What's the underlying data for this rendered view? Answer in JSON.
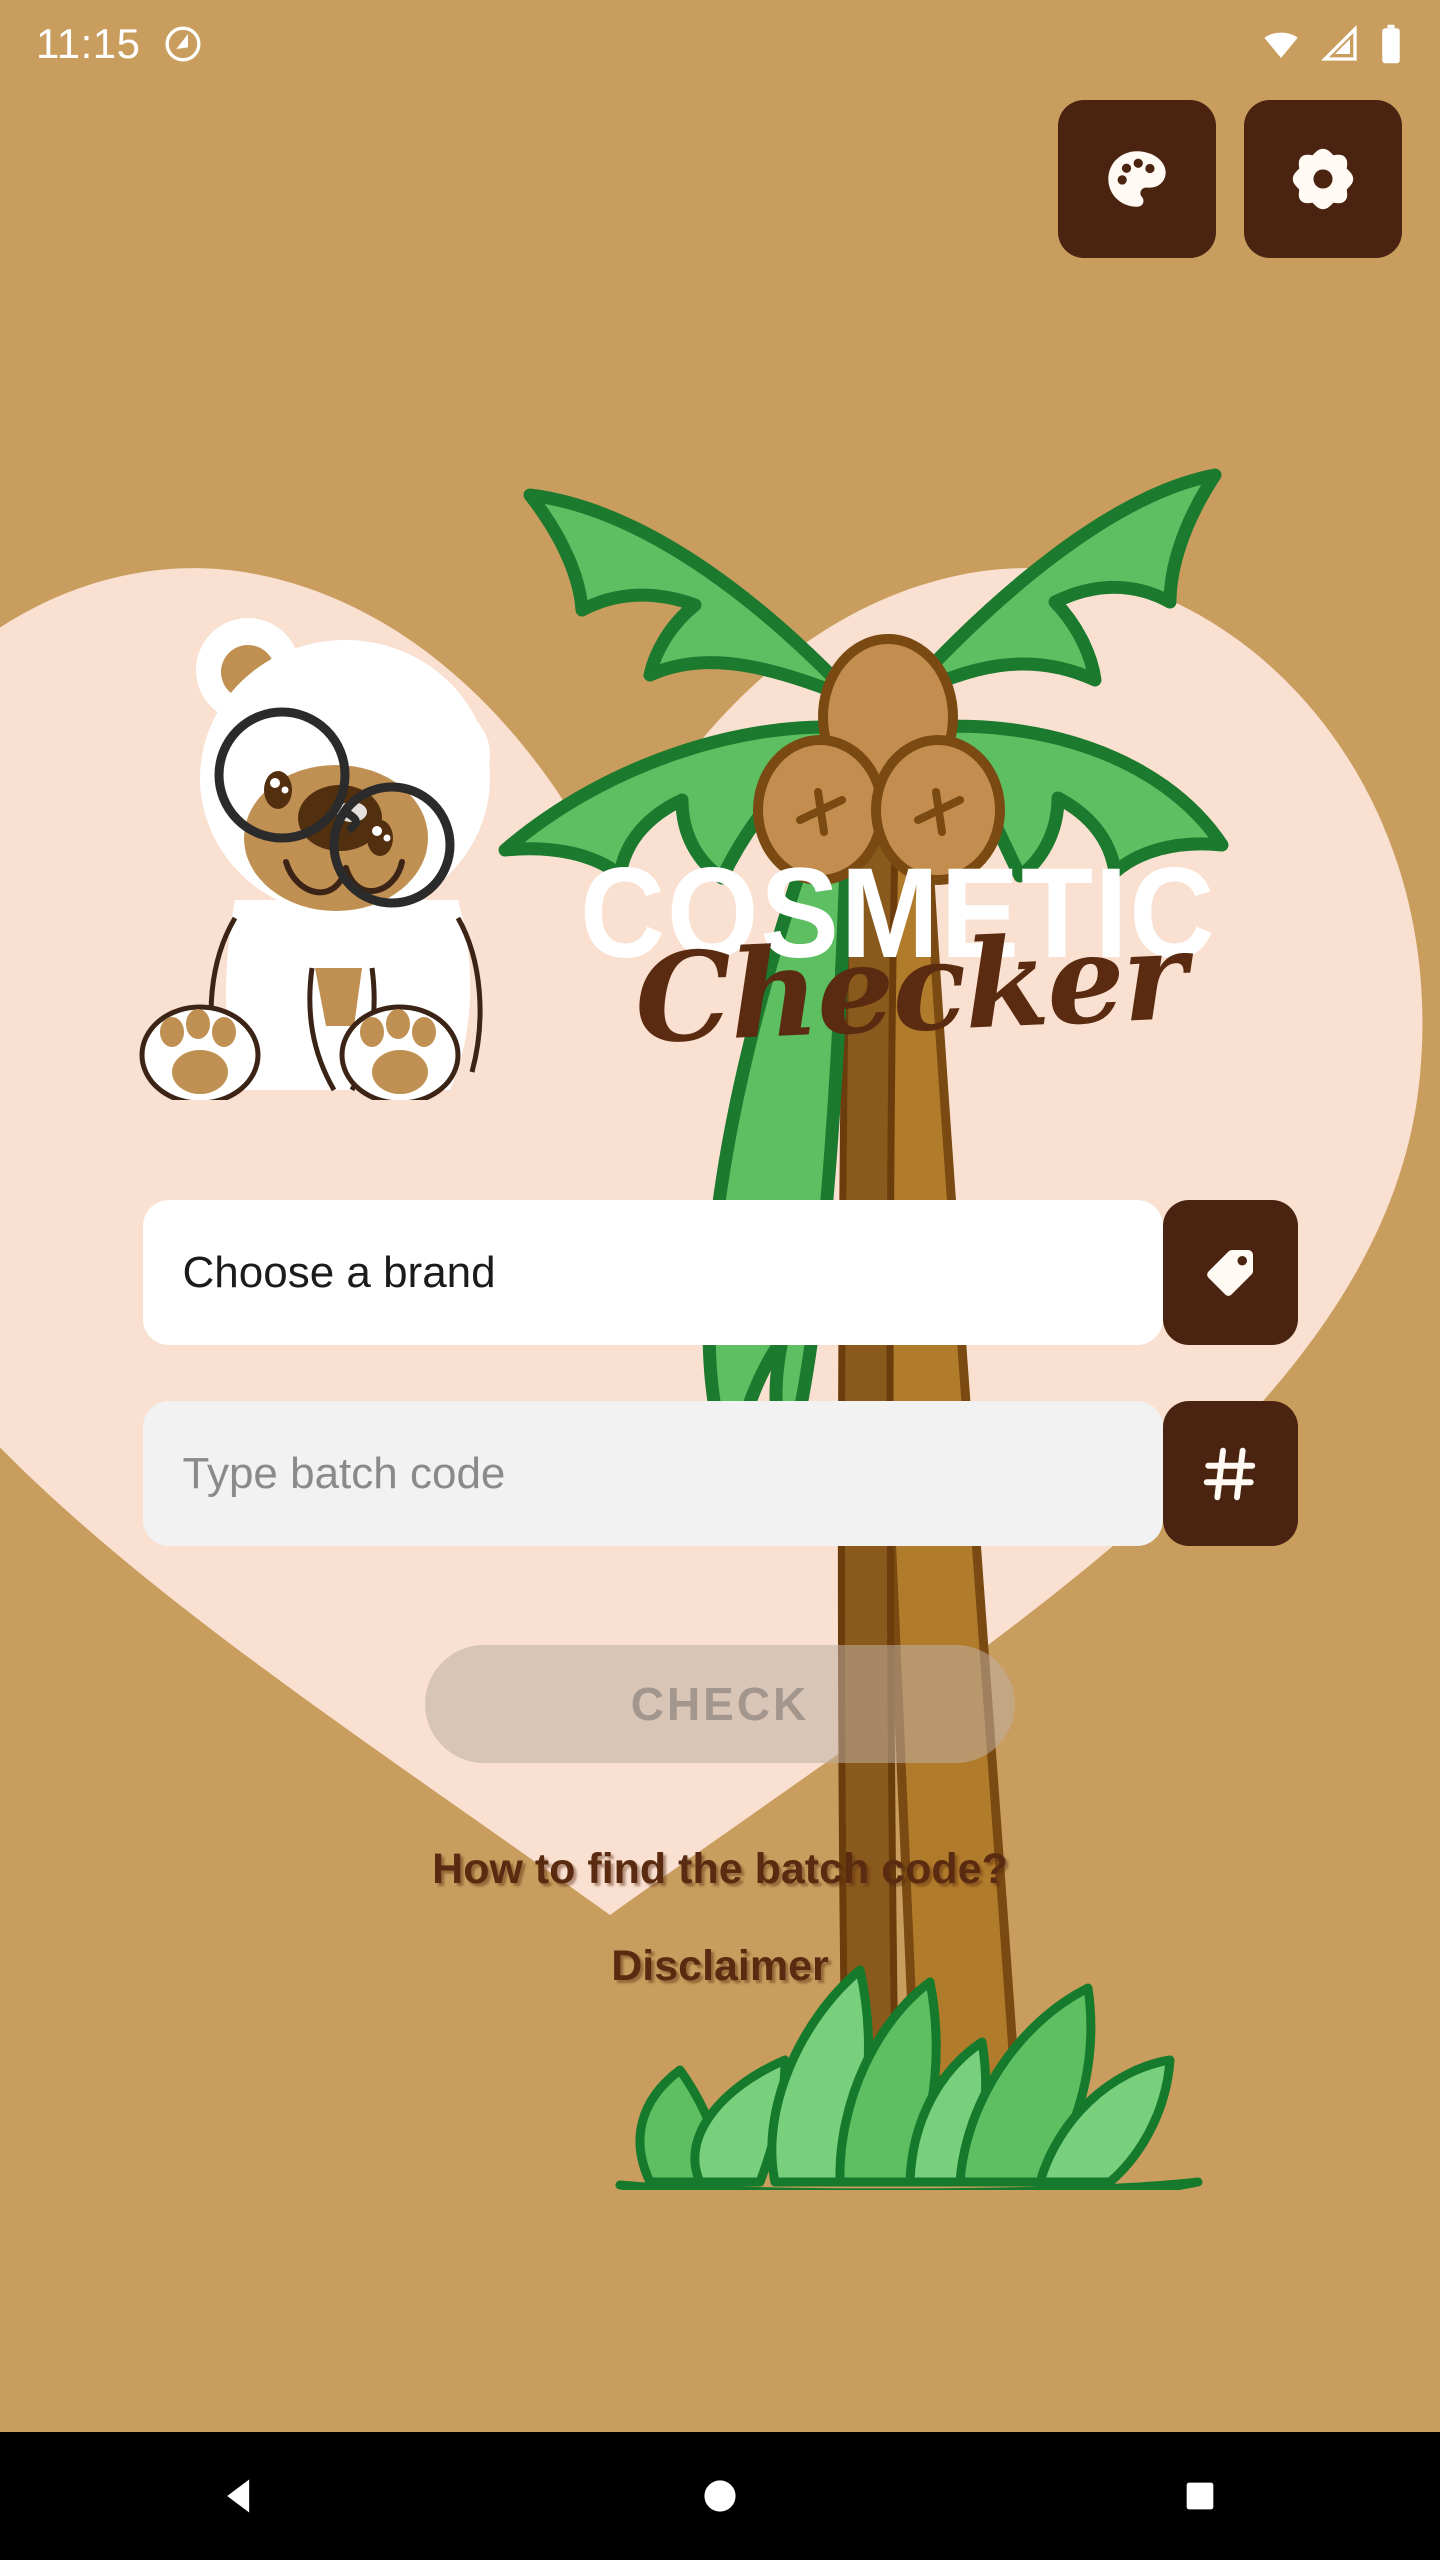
{
  "status_bar": {
    "clock": "11:15",
    "notification_icon": "app-notification-icon",
    "wifi_icon": "wifi-icon",
    "signal_icon": "cellular-signal-icon",
    "battery_icon": "battery-full-icon"
  },
  "top_actions": {
    "theme_button": {
      "name": "palette-icon",
      "label": "Theme"
    },
    "settings_button": {
      "name": "gear-icon",
      "label": "Settings"
    }
  },
  "logo": {
    "line1": "COSMETIC",
    "line2": "Checker"
  },
  "form": {
    "brand": {
      "value": "Choose a brand",
      "placeholder": "Choose a brand",
      "icon": "tag-icon"
    },
    "batch": {
      "value": "",
      "placeholder": "Type batch code",
      "icon": "hash-icon"
    },
    "check_button": {
      "label": "CHECK",
      "enabled": false
    }
  },
  "links": {
    "how_to_find": "How to find the batch code?",
    "disclaimer": "Disclaimer"
  },
  "nav_bar": {
    "back": "back-icon",
    "home": "home-icon",
    "recents": "recents-icon"
  },
  "colors": {
    "background": "#c99d5e",
    "heart": "#fae0d0",
    "dark_brown": "#4a2410",
    "text_brown": "#5a2b10",
    "field_white": "#ffffff",
    "field_gray": "#f2f2f2",
    "placeholder_gray": "#8a8a8a",
    "leaf_green": "#4caf50",
    "leaf_outline": "#1b7a2e",
    "trunk_brown": "#b07b2a"
  }
}
